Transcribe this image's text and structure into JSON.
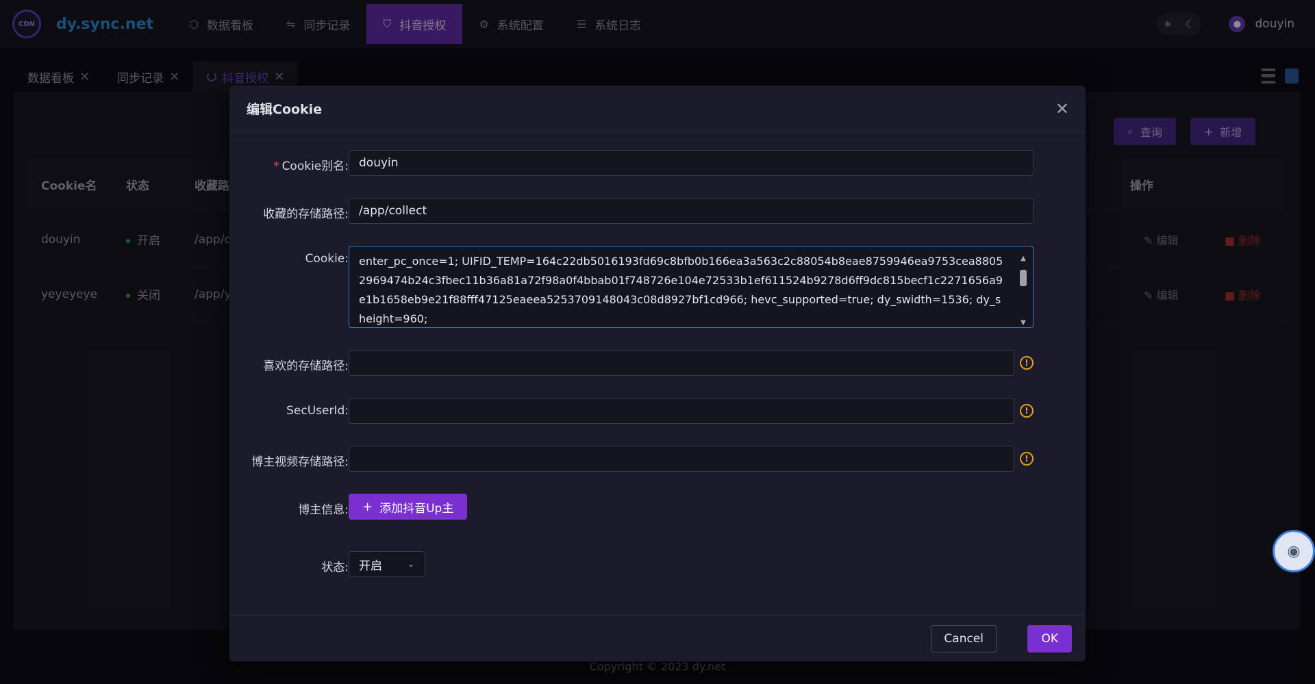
{
  "header": {
    "logo_badge": "CDN",
    "app_title": "dy.sync.net",
    "nav": [
      {
        "label": "数据看板",
        "icon": "dashboard-icon"
      },
      {
        "label": "同步记录",
        "icon": "sync-icon"
      },
      {
        "label": "抖音授权",
        "icon": "shield-icon",
        "active": true
      },
      {
        "label": "系统配置",
        "icon": "gear-icon"
      },
      {
        "label": "系统日志",
        "icon": "list-icon"
      }
    ],
    "username": "douyin"
  },
  "tabs": [
    {
      "label": "数据看板"
    },
    {
      "label": "同步记录"
    },
    {
      "label": "抖音授权",
      "active": true
    }
  ],
  "toolbar": {
    "query_label": "查询",
    "add_label": "新增"
  },
  "table": {
    "columns": [
      "Cookie名",
      "状态",
      "收藏路",
      "操作"
    ],
    "rows": [
      {
        "name": "douyin",
        "status": "开启",
        "path": "/app/c",
        "edit": "编辑",
        "delete": "删除"
      },
      {
        "name": "yeyeyeye",
        "status": "关闭",
        "path": "/app/y",
        "edit": "编辑",
        "delete": "删除"
      }
    ]
  },
  "footer": {
    "copyright": "Copyright © 2023 dy.net"
  },
  "modal": {
    "title": "编辑Cookie",
    "fields": {
      "alias_label": "Cookie别名:",
      "alias_value": "douyin",
      "collect_label": "收藏的存储路径:",
      "collect_value": "/app/collect",
      "cookie_label": "Cookie:",
      "cookie_value": "enter_pc_once=1; UIFID_TEMP=164c22db5016193fd69c8bfb0b166ea3a563c2c88054b8eae8759946ea9753cea88052969474b24c3fbec11b36a81a72f98a0f4bbab01f748726e104e72533b1ef611524b9278d6ff9dc815becf1c2271656a9e1b1658eb9e21f88fff47125eaeea5253709148043c08d8927bf1cd966; hevc_supported=true; dy_swidth=1536; dy_sheight=960;",
      "like_label": "喜欢的存储路径:",
      "like_value": "",
      "secuid_label": "SecUserId:",
      "secuid_value": "",
      "upvideo_label": "博主视频存储路径:",
      "upvideo_value": "",
      "up_info_label": "博主信息:",
      "add_up_label": "添加抖音Up主",
      "status_label": "状态:",
      "status_value": "开启"
    },
    "cancel_label": "Cancel",
    "ok_label": "OK"
  },
  "colors": {
    "accent": "#7a2fd0",
    "brand_text": "#2d93e0",
    "danger": "#b7332f",
    "success": "#3aa84a",
    "warning": "#e0a020"
  }
}
